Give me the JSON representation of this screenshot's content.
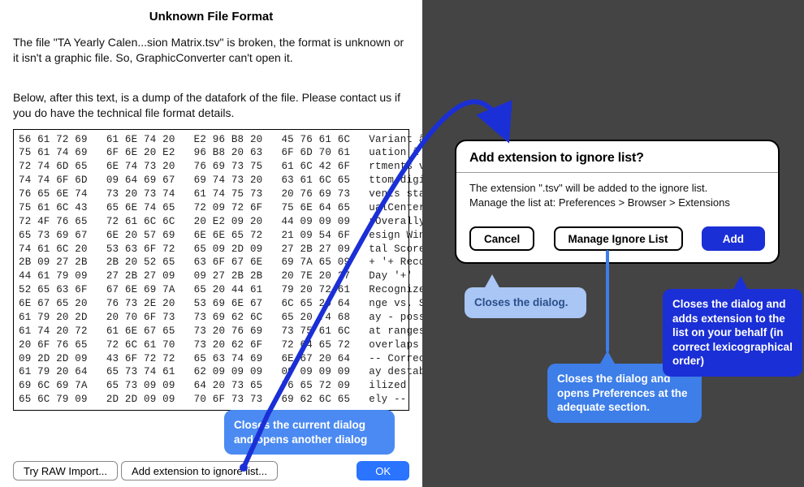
{
  "dialog1": {
    "title": "Unknown File Format",
    "paragraph1": "The file \"TA Yearly Calen...sion Matrix.tsv\" is broken, the format is unknown or it isn't a graphic file. So, GraphicConverter can't open it.",
    "paragraph2": "Below, after this text, is a dump of the datafork of the file. Please contact us if you do have the technical file format details.",
    "dump": "56 61 72 69   61 6E 74 20   E2 96 B8 20   45 76 61 6C   Variant â ¸ Eval\n75 61 74 69   6F 6E 20 E2   96 B8 20 63   6F 6D 70 61   uation â ¾ compar\n72 74 6D 65   6E 74 73 20   76 69 73 75   61 6C 42 6F   rtments visual Bo\n74 74 6F 6D   09 64 69 67   69 74 73 20   63 61 6C 65   ttom digits cale\n76 65 6E 74   73 20 73 74   61 74 75 73   20 76 69 73   vents status vis\n75 61 6C 43   65 6E 74 65   72 09 72 6F   75 6E 64 65   ualCenter rounde\n72 4F 76 65   72 61 6C 6C   20 E2 09 20   44 09 09 09   rOverally â    D\n65 73 69 67   6E 20 57 69   6E 6E 65 72   21 09 54 6F   esign Winner! To\n74 61 6C 20   53 63 6F 72   65 09 2D 09   27 2B 27 09   tal Score - '+'\n2B 09 27 2B   2B 20 52 65   63 6F 67 6E   69 7A 65 09   + '+ Recognize\n44 61 79 09   27 2B 27 09   09 27 2B 2B   20 7E 20 27   Day '+'  '+  + '\n52 65 63 6F   67 6E 69 7A   65 20 44 61   79 20 72 61   Recognize Day ra\n6E 67 65 20   76 73 2E 20   53 69 6E 67   6C 65 20 64   nge vs. Single d\n61 79 20 2D   20 70 6F 73   73 69 62 6C   65 20 74 68   ay - possible th\n61 74 20 72   61 6E 67 65   73 20 76 69   73 75 61 6C   at ranges visual\n20 6F 76 65   72 6C 61 70   73 20 62 6F   72 64 65 72   overlaps border\n09 2D 2D 09   43 6F 72 72   65 63 74 69   6E 67 20 64   -- Correcting d\n61 79 20 64   65 73 74 61   62 09 09 09   09 09 09 09   ay destab\n69 6C 69 7A   65 73 09 09   64 20 73 65   76 65 72 09   ilized   d sever\n65 6C 79 09   2D 2D 09 09   70 6F 73 73   69 62 6C 65   ely --   possible t",
    "buttons": {
      "try_raw": "Try RAW Import...",
      "add_ext": "Add extension to ignore list...",
      "ok": "OK"
    }
  },
  "dialog2": {
    "title": "Add extension to ignore list?",
    "line1": "The extension \".tsv\" will be added to the ignore list.",
    "line2": "Manage the list at: Preferences > Browser > Extensions",
    "buttons": {
      "cancel": "Cancel",
      "manage": "Manage Ignore List",
      "add": "Add"
    }
  },
  "callouts": {
    "main_arrow": "Closes the current dialog and opens another dialog",
    "cancel_note": "Closes the dialog.",
    "manage_note": "Closes the dialog and opens Preferences at the adequate section.",
    "add_note": "Closes the dialog and adds extension to the list on your behalf (in correct lexicographical order)"
  }
}
